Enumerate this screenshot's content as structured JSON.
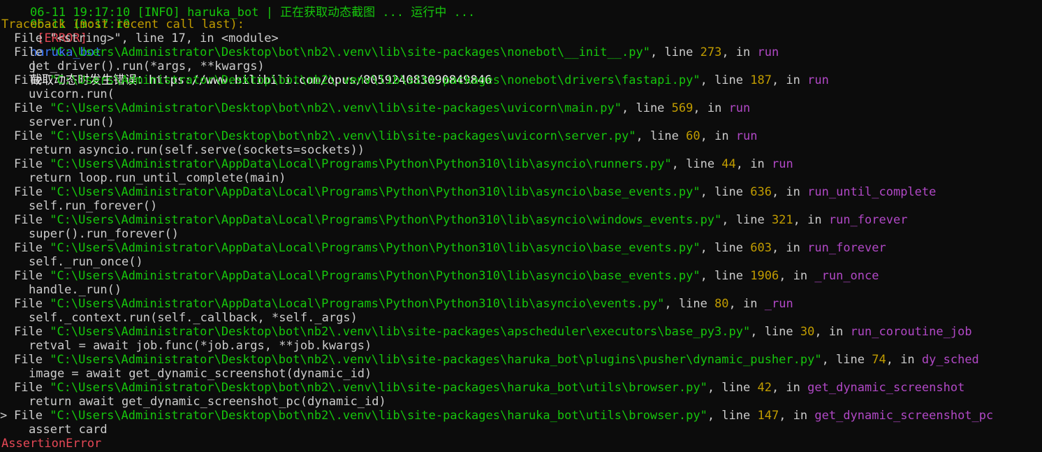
{
  "colors": {
    "background": "#0c0c0c",
    "text": "#cccccc",
    "path": "#16c60c",
    "line_number": "#c19c00",
    "function": "#b148c6",
    "error": "#e74856",
    "keyword": "#b148c6"
  },
  "top_cutoff": "06-11 19:17:10 [INFO] haruka_bot | 正在获取动态截图 ... 运行中 ...",
  "log": {
    "timestamp": "06-11 19:17:10",
    "level": "[ERROR]",
    "source": "haruka_bot",
    "separator": "|",
    "message": "截取动态时发生错误：https://www.bilibili.com/opus/805924083090849846"
  },
  "traceback_header": "Traceback (most recent call last):",
  "frames": [
    {
      "kw": "File",
      "path": "\"<string>\"",
      "comma_line": ", line ",
      "line": "17",
      "in": ", in ",
      "func": "<module>",
      "plain": true,
      "code": ""
    },
    {
      "kw": "File",
      "path": "\"C:\\Users\\Administrator\\Desktop\\bot\\nb2\\.venv\\lib\\site-packages\\nonebot\\__init__.py\"",
      "comma_line": ", line ",
      "line": "273",
      "in": ", in ",
      "func": "run",
      "code": "get_driver().run(*args, **kwargs)"
    },
    {
      "kw": "File",
      "path": "\"C:\\Users\\Administrator\\Desktop\\bot\\nb2\\.venv\\lib\\site-packages\\nonebot\\drivers\\fastapi.py\"",
      "comma_line": ", line ",
      "line": "187",
      "in": ", in ",
      "func": "run",
      "code": "uvicorn.run("
    },
    {
      "kw": "File",
      "path": "\"C:\\Users\\Administrator\\Desktop\\bot\\nb2\\.venv\\lib\\site-packages\\uvicorn\\main.py\"",
      "comma_line": ", line ",
      "line": "569",
      "in": ", in ",
      "func": "run",
      "code": "server.run()"
    },
    {
      "kw": "File",
      "path": "\"C:\\Users\\Administrator\\Desktop\\bot\\nb2\\.venv\\lib\\site-packages\\uvicorn\\server.py\"",
      "comma_line": ", line ",
      "line": "60",
      "in": ", in ",
      "func": "run",
      "code": "return asyncio.run(self.serve(sockets=sockets))"
    },
    {
      "kw": "File",
      "path": "\"C:\\Users\\Administrator\\AppData\\Local\\Programs\\Python\\Python310\\lib\\asyncio\\runners.py\"",
      "comma_line": ", line ",
      "line": "44",
      "in": ", in ",
      "func": "run",
      "code": "return loop.run_until_complete(main)"
    },
    {
      "kw": "File",
      "path": "\"C:\\Users\\Administrator\\AppData\\Local\\Programs\\Python\\Python310\\lib\\asyncio\\base_events.py\"",
      "comma_line": ", line ",
      "line": "636",
      "in": ", in ",
      "func": "run_until_complete",
      "code": "self.run_forever()"
    },
    {
      "kw": "File",
      "path": "\"C:\\Users\\Administrator\\AppData\\Local\\Programs\\Python\\Python310\\lib\\asyncio\\windows_events.py\"",
      "comma_line": ", line ",
      "line": "321",
      "in": ", in ",
      "func": "run_forever",
      "code": "super().run_forever()"
    },
    {
      "kw": "File",
      "path": "\"C:\\Users\\Administrator\\AppData\\Local\\Programs\\Python\\Python310\\lib\\asyncio\\base_events.py\"",
      "comma_line": ", line ",
      "line": "603",
      "in": ", in ",
      "func": "run_forever",
      "code": "self._run_once()"
    },
    {
      "kw": "File",
      "path": "\"C:\\Users\\Administrator\\AppData\\Local\\Programs\\Python\\Python310\\lib\\asyncio\\base_events.py\"",
      "comma_line": ", line ",
      "line": "1906",
      "in": ", in ",
      "func": "_run_once",
      "code": "handle._run()"
    },
    {
      "kw": "File",
      "path": "\"C:\\Users\\Administrator\\AppData\\Local\\Programs\\Python\\Python310\\lib\\asyncio\\events.py\"",
      "comma_line": ", line ",
      "line": "80",
      "in": ", in ",
      "func": "_run",
      "code": "self._context.run(self._callback, *self._args)"
    },
    {
      "kw": "File",
      "path": "\"C:\\Users\\Administrator\\Desktop\\bot\\nb2\\.venv\\lib\\site-packages\\apscheduler\\executors\\base_py3.py\"",
      "comma_line": ", line ",
      "line": "30",
      "in": ", in ",
      "func": "run_coroutine_job",
      "code": "retval = await job.func(*job.args, **job.kwargs)"
    },
    {
      "kw": "File",
      "path": "\"C:\\Users\\Administrator\\Desktop\\bot\\nb2\\.venv\\lib\\site-packages\\haruka_bot\\plugins\\pusher\\dynamic_pusher.py\"",
      "comma_line": ", line ",
      "line": "74",
      "in": ", in ",
      "func": "dy_sched",
      "code": "image = await get_dynamic_screenshot(dynamic_id)"
    },
    {
      "kw": "File",
      "path": "\"C:\\Users\\Administrator\\Desktop\\bot\\nb2\\.venv\\lib\\site-packages\\haruka_bot\\utils\\browser.py\"",
      "comma_line": ", line ",
      "line": "42",
      "in": ", in ",
      "func": "get_dynamic_screenshot",
      "code": "return await get_dynamic_screenshot_pc(dynamic_id)"
    },
    {
      "kw": "File",
      "path": "\"C:\\Users\\Administrator\\Desktop\\bot\\nb2\\.venv\\lib\\site-packages\\haruka_bot\\utils\\browser.py\"",
      "comma_line": ", line ",
      "line": "147",
      "in": ", in ",
      "func": "get_dynamic_screenshot_pc",
      "code": "assert card"
    }
  ],
  "exception": "AssertionError",
  "prompt_marker": ">"
}
